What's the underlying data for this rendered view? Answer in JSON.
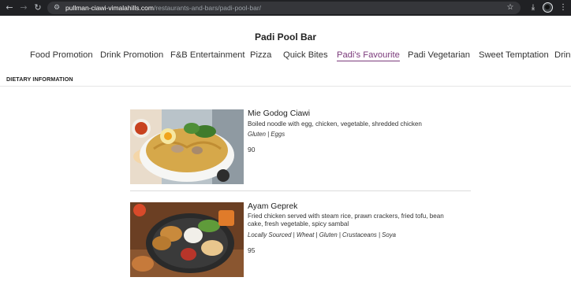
{
  "browser": {
    "url_host": "pullman-ciawi-vimalahills.com",
    "url_path": "/restaurants-and-bars/padi-pool-bar/"
  },
  "page": {
    "title": "Padi Pool Bar",
    "dietary_label": "DIETARY INFORMATION"
  },
  "tabs": [
    {
      "label": "Food Promotion",
      "active": false
    },
    {
      "label": "Drink Promotion",
      "active": false
    },
    {
      "label": "F&B Entertainment",
      "active": false
    },
    {
      "label": "Pizza",
      "active": false
    },
    {
      "label": "Quick Bites",
      "active": false
    },
    {
      "label": "Padi's Favourite",
      "active": true
    },
    {
      "label": "Padi Vegetarian",
      "active": false
    },
    {
      "label": "Sweet Temptation",
      "active": false
    },
    {
      "label": "Drink",
      "active": false
    }
  ],
  "items": [
    {
      "name": "Mie Godog Ciawi",
      "description": "Boiled noodle with egg, chicken, vegetable, shredded chicken",
      "tags": "Gluten | Eggs",
      "price": "90"
    },
    {
      "name": "Ayam Geprek",
      "description": "Fried chicken served with steam rice, prawn crackers, fried tofu, bean cake, fresh vegetable, spicy sambal",
      "tags": "Locally Sourced | Wheat | Gluten | Crustaceans | Soya",
      "price": "95"
    }
  ],
  "colors": {
    "active_tab": "#7b3a7b",
    "chrome_bg": "#202124"
  }
}
